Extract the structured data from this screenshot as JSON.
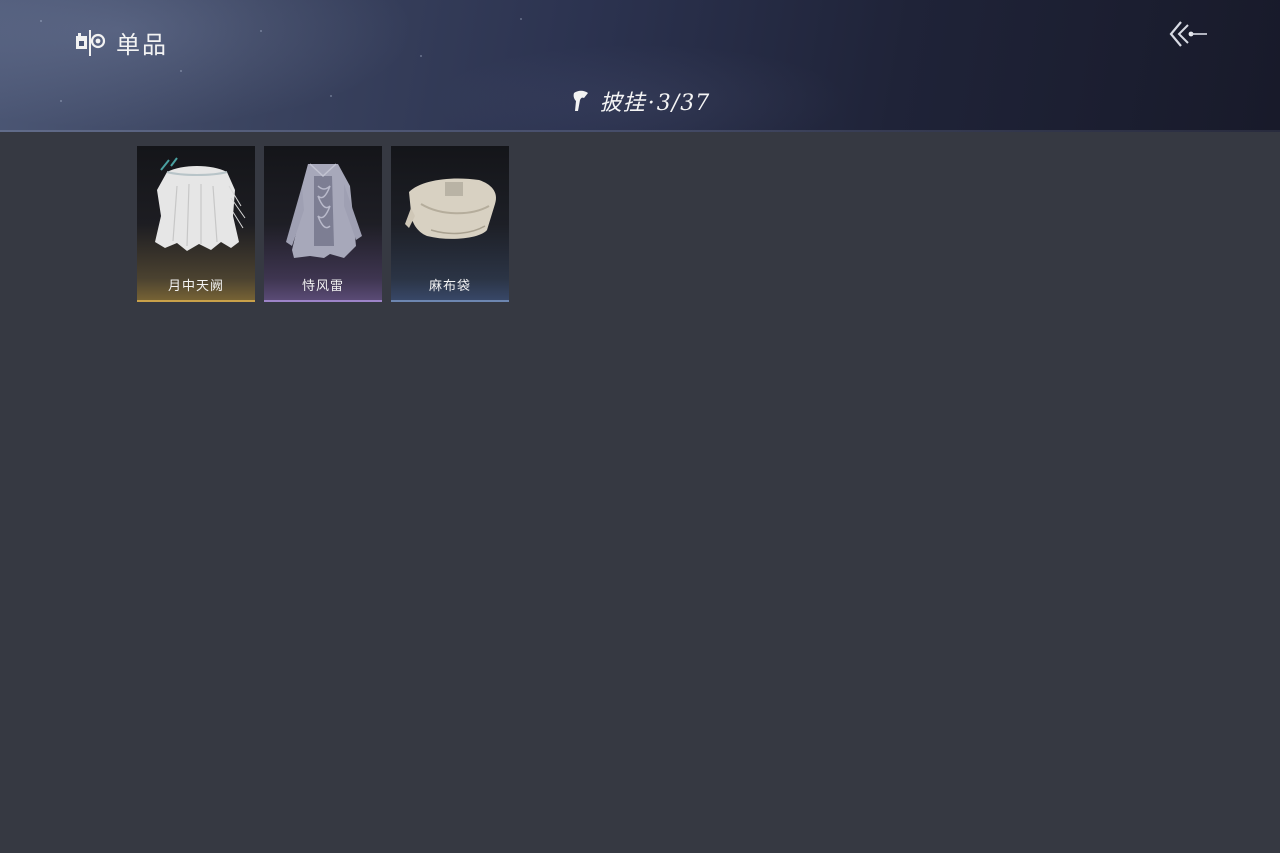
{
  "header": {
    "section_label": "单品",
    "category": {
      "name": "披挂",
      "separator": "·",
      "owned": "3",
      "total": "37",
      "count_slash": "/"
    },
    "back_icon": "back-arrow-icon"
  },
  "items": [
    {
      "name": "月中天阙",
      "rarity_color": "#c9a14a",
      "icon": "white-feather-cape-icon"
    },
    {
      "name": "恃风雷",
      "rarity_color": "#9d84c8",
      "icon": "patterned-robe-icon"
    },
    {
      "name": "麻布袋",
      "rarity_color": "#6d86b0",
      "icon": "linen-sack-icon"
    }
  ]
}
